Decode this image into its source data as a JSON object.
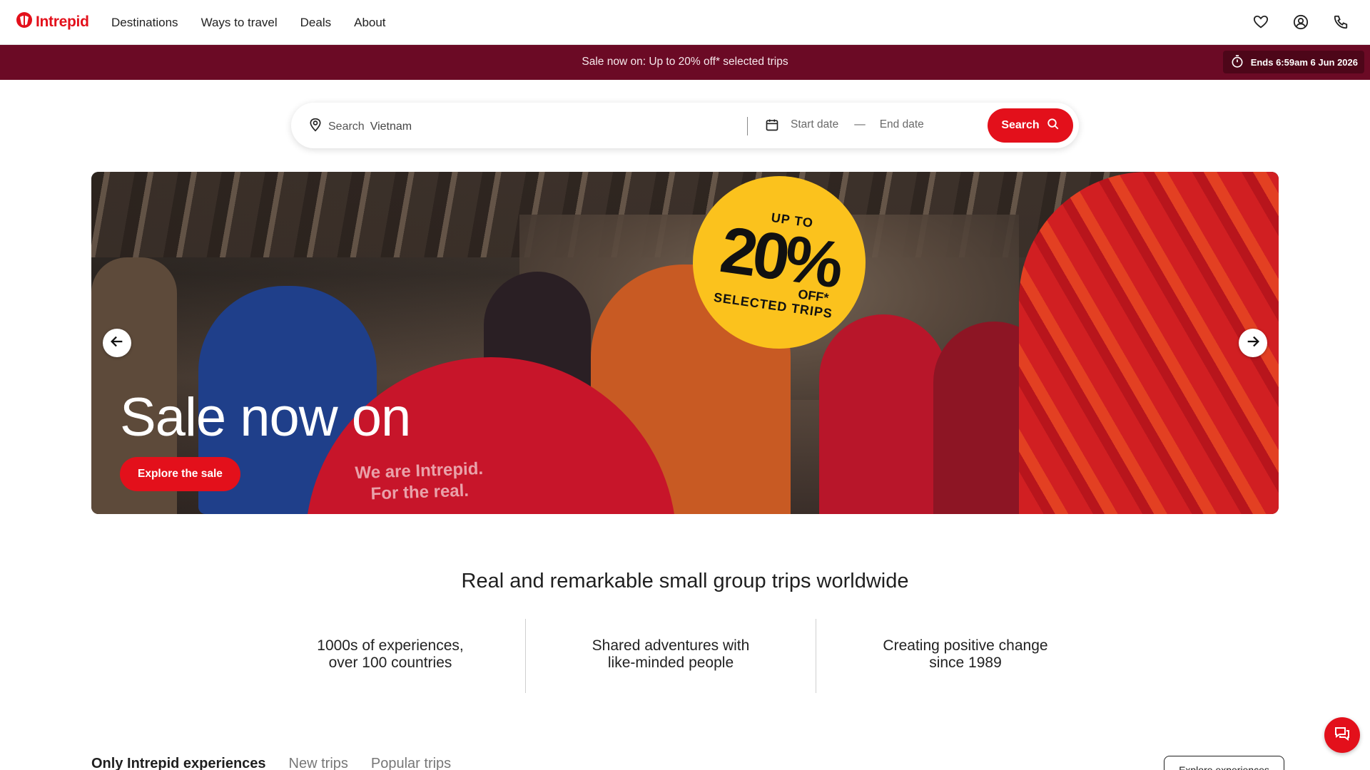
{
  "header": {
    "brand": "Intrepid",
    "nav": [
      {
        "label": "Destinations"
      },
      {
        "label": "Ways to travel"
      },
      {
        "label": "Deals"
      },
      {
        "label": "About"
      }
    ],
    "icons": [
      "heart-icon",
      "account-icon",
      "phone-icon"
    ]
  },
  "promo": {
    "text": "Sale now on: Up to 20% off* selected trips",
    "timer": "Ends 6:59am 6 Jun 2026"
  },
  "search": {
    "label": "Search",
    "placeholder": "Vietnam",
    "start_date_placeholder": "Start date",
    "separator": "—",
    "end_date_placeholder": "End date",
    "button_label": "Search"
  },
  "hero": {
    "badge_line1": "UP TO",
    "badge_big": "20%",
    "badge_line2": "OFF*",
    "badge_line3": "SELECTED TRIPS",
    "shirt_line1": "We are Intrepid.",
    "shirt_line2": "For the real.",
    "title": "Sale now on",
    "cta": "Explore the sale"
  },
  "tagline": "Real and remarkable small group trips worldwide",
  "features": [
    {
      "line1": "1000s of experiences,",
      "line2": "over 100 countries"
    },
    {
      "line1": "Shared adventures with",
      "line2": "like-minded people"
    },
    {
      "line1": "Creating positive change",
      "line2": "since 1989"
    }
  ],
  "tabs": [
    {
      "label": "Only Intrepid experiences",
      "active": true
    },
    {
      "label": "New trips",
      "active": false
    },
    {
      "label": "Popular trips",
      "active": false
    }
  ],
  "explore_button": "Explore experiences",
  "colors": {
    "brand_red": "#e3101b",
    "promo_bg": "#6b0a25",
    "badge_yellow": "#fbc21d"
  }
}
